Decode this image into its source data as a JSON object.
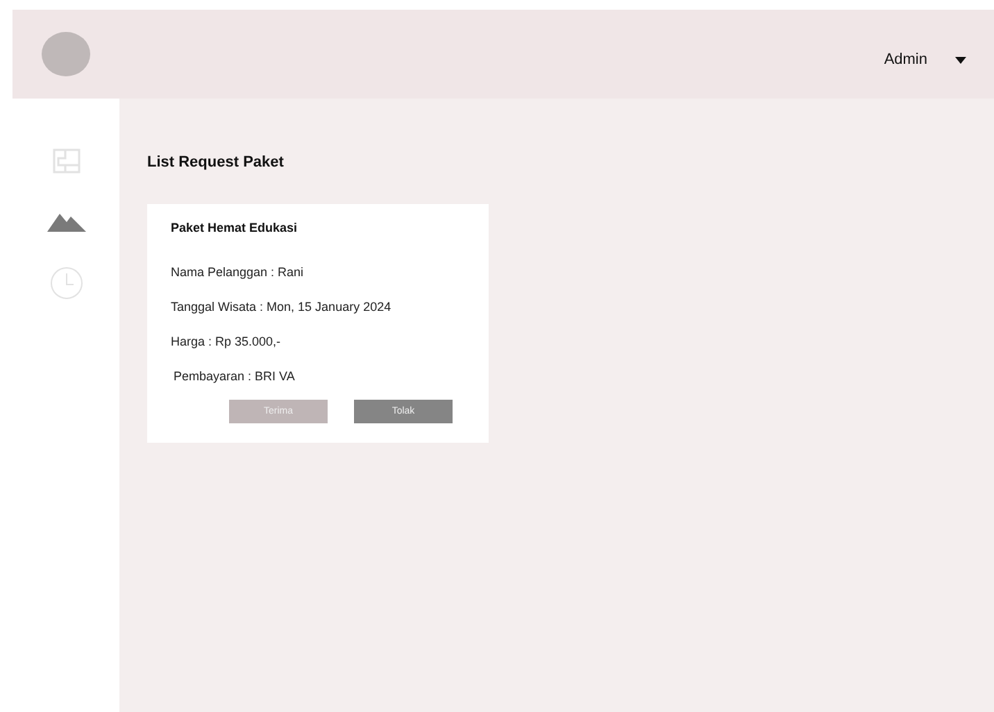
{
  "header": {
    "user": "Admin"
  },
  "sidebar": {
    "items": [
      {
        "selected": false
      },
      {
        "selected": true
      },
      {
        "selected": false
      }
    ]
  },
  "page_title": "List Request Paket",
  "requests": [
    {
      "title": "Paket Hemat Edukasi",
      "fields": [
        "Nama Pelanggan : Rani",
        "Tanggal Wisata : Mon, 15 January 2024",
        "Harga : Rp 35.000,-",
        "Pembayaran : BRI VA"
      ],
      "buttons": [
        {
          "label": "Terima",
          "kind": "accept"
        },
        {
          "label": "Tolak",
          "kind": "reject"
        }
      ]
    }
  ]
}
